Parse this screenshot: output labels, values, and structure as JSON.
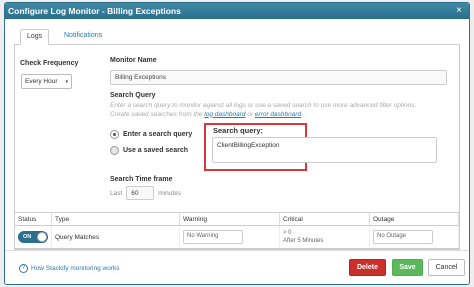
{
  "dialog": {
    "title": "Configure Log Monitor - Billing Exceptions",
    "close": "×"
  },
  "tabs": [
    {
      "label": "Logs"
    },
    {
      "label": "Notifications"
    }
  ],
  "check_frequency": {
    "label": "Check Frequency",
    "value": "Every Hour",
    "caret": "▾"
  },
  "monitor_name": {
    "label": "Monitor Name",
    "value": "Billing Exceptions"
  },
  "search_query": {
    "label": "Search Query",
    "hint_line1": "Enter a search query to monitor against all logs or use a saved search to use more advanced filter options.",
    "hint_line2_pre": "Create saved searches from the ",
    "hint_link1": "log dashboard",
    "hint_or": " or ",
    "hint_link2": "error dashboard",
    "hint_end": ".",
    "option_enter": "Enter a search query",
    "option_saved": "Use a saved search",
    "query_label": "Search query:",
    "query_value": "ClientBillingException"
  },
  "time_frame": {
    "label": "Search Time frame",
    "prefix": "Last",
    "value": "60",
    "unit": "minutes"
  },
  "table": {
    "headers": [
      "Status",
      "Type",
      "Warning",
      "Critical",
      "Outage"
    ],
    "row": {
      "status": "ON",
      "type": "Query Matches",
      "warning": "No Warning",
      "critical_line1": "> 0",
      "critical_line2": "After 5 Minutes",
      "outage": "No Outage"
    }
  },
  "footer": {
    "help": "How Stackify monitoring works",
    "help_icon": "?",
    "delete": "Delete",
    "save": "Save",
    "cancel": "Cancel"
  },
  "colors": {
    "titlebar": "#2a6f8c",
    "delete": "#c9302c",
    "save": "#5cb85c",
    "highlight": "#d9363e",
    "link": "#2a7ab0"
  }
}
